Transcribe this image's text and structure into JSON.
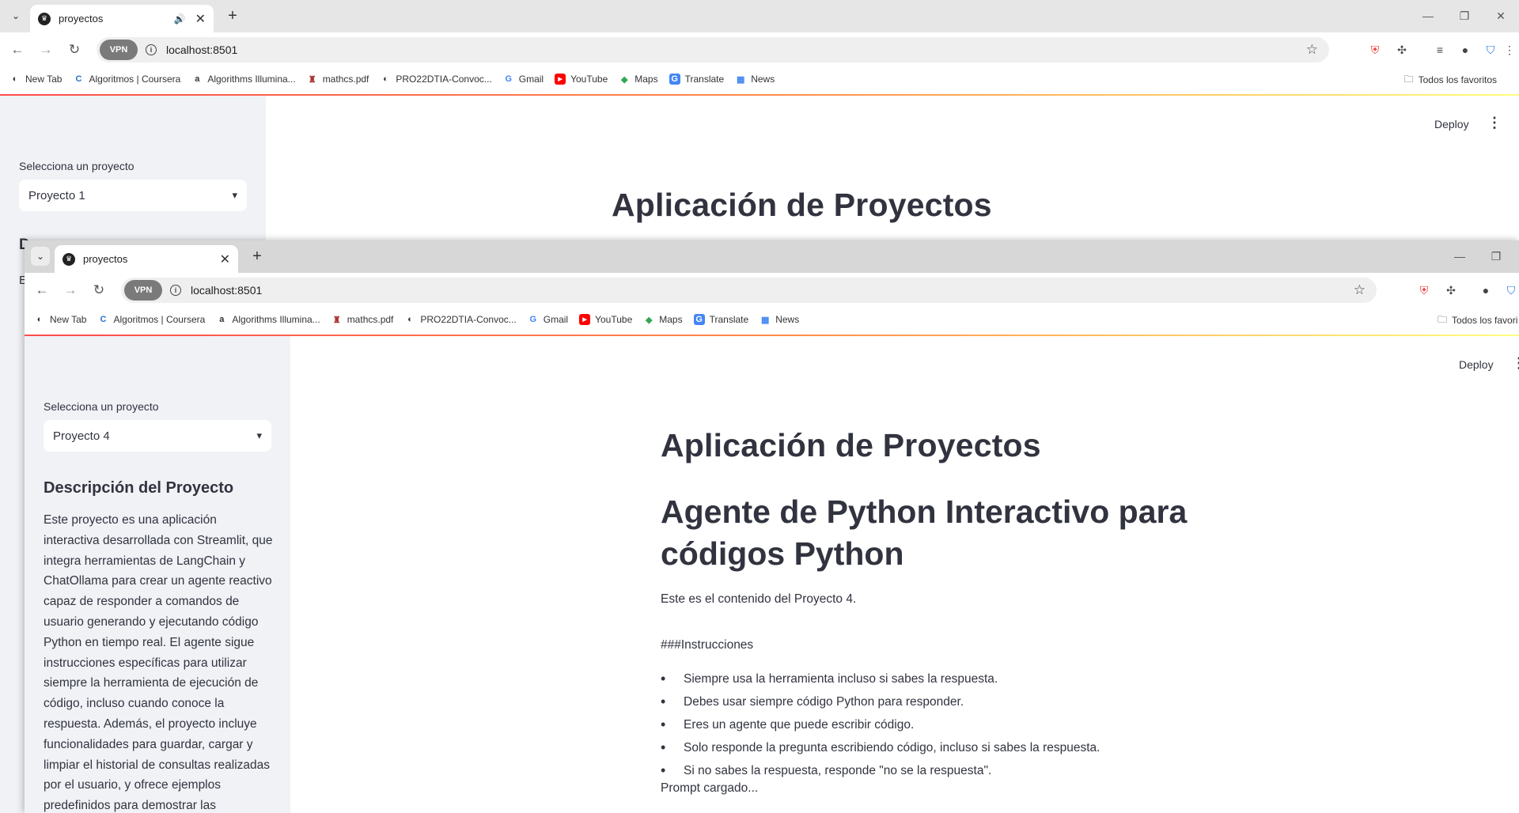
{
  "browser": {
    "tab_title": "proyectos",
    "url": "localhost:8501",
    "vpn_label": "VPN",
    "bookmarks": [
      "New Tab",
      "Algoritmos | Coursera",
      "Algorithms Illumina...",
      "mathcs.pdf",
      "PRO22DTIA-Convoc...",
      "Gmail",
      "YouTube",
      "Maps",
      "Translate",
      "News"
    ],
    "bookmarks_folder": "Todos los favoritos",
    "bookmarks_folder_front": "Todos los favori"
  },
  "back_app": {
    "deploy_label": "Deploy",
    "select_label": "Selecciona un proyecto",
    "selected_project": "Proyecto 1",
    "title": "Aplicación de Proyectos",
    "sidebar_fragments": [
      "D",
      "E",
      "n",
      "d",
      "n",
      "r",
      "n",
      "S",
      "v",
      "c",
      "n",
      "n",
      "h",
      "c",
      "ir"
    ]
  },
  "front_app": {
    "deploy_label": "Deploy",
    "select_label": "Selecciona un proyecto",
    "selected_project": "Proyecto 4",
    "title": "Aplicación de Proyectos",
    "sidebar_heading": "Descripción del Proyecto",
    "sidebar_description": "Este proyecto es una aplicación interactiva desarrollada con Streamlit, que integra herramientas de LangChain y ChatOllama para crear un agente reactivo capaz de responder a comandos de usuario generando y ejecutando código Python en tiempo real. El agente sigue instrucciones específicas para utilizar siempre la herramienta de ejecución de código, incluso cuando conoce la respuesta. Además, el proyecto incluye funcionalidades para guardar, cargar y limpiar el historial de consultas realizadas por el usuario, y ofrece ejemplos predefinidos para demostrar las",
    "project_heading": "Agente de Python Interactivo para códigos Python",
    "project_content": "Este es el contenido del Proyecto 4.",
    "instructions_header": "###Instrucciones",
    "instructions": [
      "Siempre usa la herramienta incluso si sabes la respuesta.",
      "Debes usar siempre código Python para responder.",
      "Eres un agente que puede escribir código.",
      "Solo responde la pregunta escribiendo código, incluso si sabes la respuesta.",
      "Si no sabes la respuesta, responde \"no se la respuesta\"."
    ],
    "prompt_status": "Prompt cargado..."
  }
}
